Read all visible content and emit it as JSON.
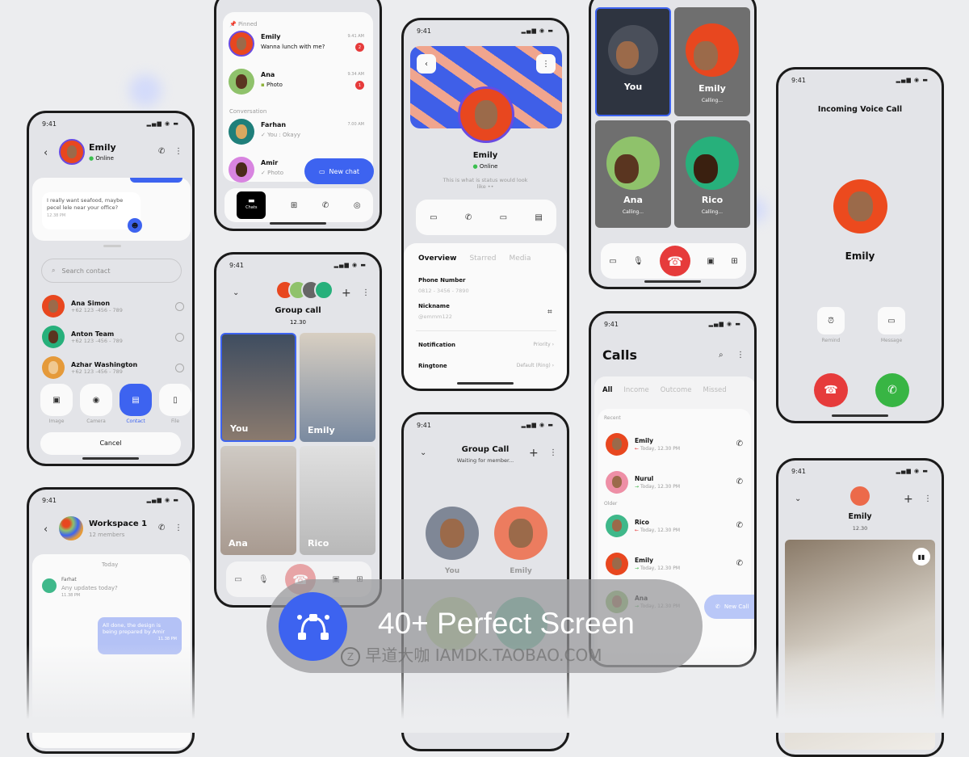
{
  "status_time": "9:41",
  "chat_share": {
    "name": "Emily",
    "status": "Online",
    "message": "I really want seafood, maybe pecel lele near your office?",
    "message_time": "12.38 PM",
    "search_placeholder": "Search contact",
    "contacts": [
      {
        "name": "Ana Simon",
        "phone": "+62 123 -456 - 789",
        "color": "#e8471f"
      },
      {
        "name": "Anton Team",
        "phone": "+62 123 -456 - 789",
        "color": "#27b07b"
      },
      {
        "name": "Azhar Washington",
        "phone": "+62 123 -456 - 789",
        "color": "#e59a3a"
      }
    ],
    "attach": [
      {
        "label": "Image",
        "icon": "image-icon"
      },
      {
        "label": "Camera",
        "icon": "camera-icon"
      },
      {
        "label": "Contact",
        "icon": "contact-icon"
      },
      {
        "label": "File",
        "icon": "file-icon"
      }
    ],
    "cancel": "Cancel"
  },
  "workspace": {
    "name": "Workspace 1",
    "members": "12 members",
    "day": "Today",
    "sender": "Farhat",
    "msg": "Any updates today?",
    "msg_time": "11.38 PM",
    "reply": "All done, the design is being prepared by Amir",
    "reply_time": "11.38 PM"
  },
  "chat_list": {
    "pinned_label": "Pinned",
    "conversation_label": "Conversation",
    "pinned": [
      {
        "name": "Emily",
        "preview": "Wanna lunch with me?",
        "time": "9.41 AM",
        "badge": "2",
        "color": "#e8471f"
      },
      {
        "name": "Ana",
        "preview": "Photo",
        "time": "9.34 AM",
        "badge": "1",
        "color": "#8fc26b"
      }
    ],
    "conversations": [
      {
        "name": "Farhan",
        "preview": "You : Okayy",
        "time": "7.00 AM",
        "color": "#1f7f7a"
      },
      {
        "name": "Amir",
        "preview": "Photo",
        "time": "",
        "color": "#d884e0"
      }
    ],
    "new_chat": "New chat",
    "nav": {
      "chats": "Chats"
    }
  },
  "group_video": {
    "title": "Group call",
    "duration": "12.30",
    "tiles": [
      "You",
      "Emily",
      "Ana",
      "Rico"
    ]
  },
  "profile": {
    "name": "Emily",
    "status": "Online",
    "bio": "This is what is status would look like ••",
    "tabs": [
      "Overview",
      "Starred",
      "Media"
    ],
    "phone_label": "Phone Number",
    "phone": "0812 - 3456 - 7890",
    "nick_label": "Nickname",
    "nick": "@emmm122",
    "notif_label": "Notification",
    "notif_value": "Priority",
    "ring_label": "Ringtone",
    "ring_value": "Default (Ring)"
  },
  "group_wait": {
    "title": "Group Call",
    "subtitle": "Waiting for member...",
    "people": [
      "You",
      "Emily"
    ]
  },
  "grid_call": {
    "tiles": [
      {
        "name": "You",
        "sub": ""
      },
      {
        "name": "Emily",
        "sub": "Calling..."
      },
      {
        "name": "Ana",
        "sub": "Calling..."
      },
      {
        "name": "Rico",
        "sub": "Calling..."
      }
    ]
  },
  "calls": {
    "title": "Calls",
    "tabs": [
      "All",
      "Income",
      "Outcome",
      "Missed"
    ],
    "recent_label": "Recent",
    "older_label": "Older",
    "recent": [
      {
        "name": "Emily",
        "time": "Today, 12.30 PM",
        "dir": "←",
        "color": "#e8471f"
      },
      {
        "name": "Nurul",
        "time": "Today, 12.30 PM",
        "dir": "→",
        "color": "#ee8fa6"
      }
    ],
    "older": [
      {
        "name": "Rico",
        "time": "Today, 12.30 PM",
        "dir": "←",
        "color": "#3fb88a"
      },
      {
        "name": "Emily",
        "time": "Today, 12.30 PM",
        "dir": "→",
        "color": "#e8471f"
      },
      {
        "name": "Ana",
        "time": "Today, 12.30 PM",
        "dir": "→",
        "color": "#8fc26b"
      }
    ],
    "new_call": "New Call"
  },
  "incoming": {
    "title": "Incoming Voice Call",
    "name": "Emily",
    "remind": "Remind",
    "message": "Message"
  },
  "video_call": {
    "name": "Emily",
    "duration": "12.30"
  },
  "banner": {
    "headline": "40+ Perfect Screen",
    "watermark": "早道大咖 IAMDK.TAOBAO.COM"
  },
  "colors": {
    "accent": "#3d63f0",
    "decline": "#e63b3b",
    "accept": "#38b544",
    "avatar_orange": "#e8471f"
  }
}
